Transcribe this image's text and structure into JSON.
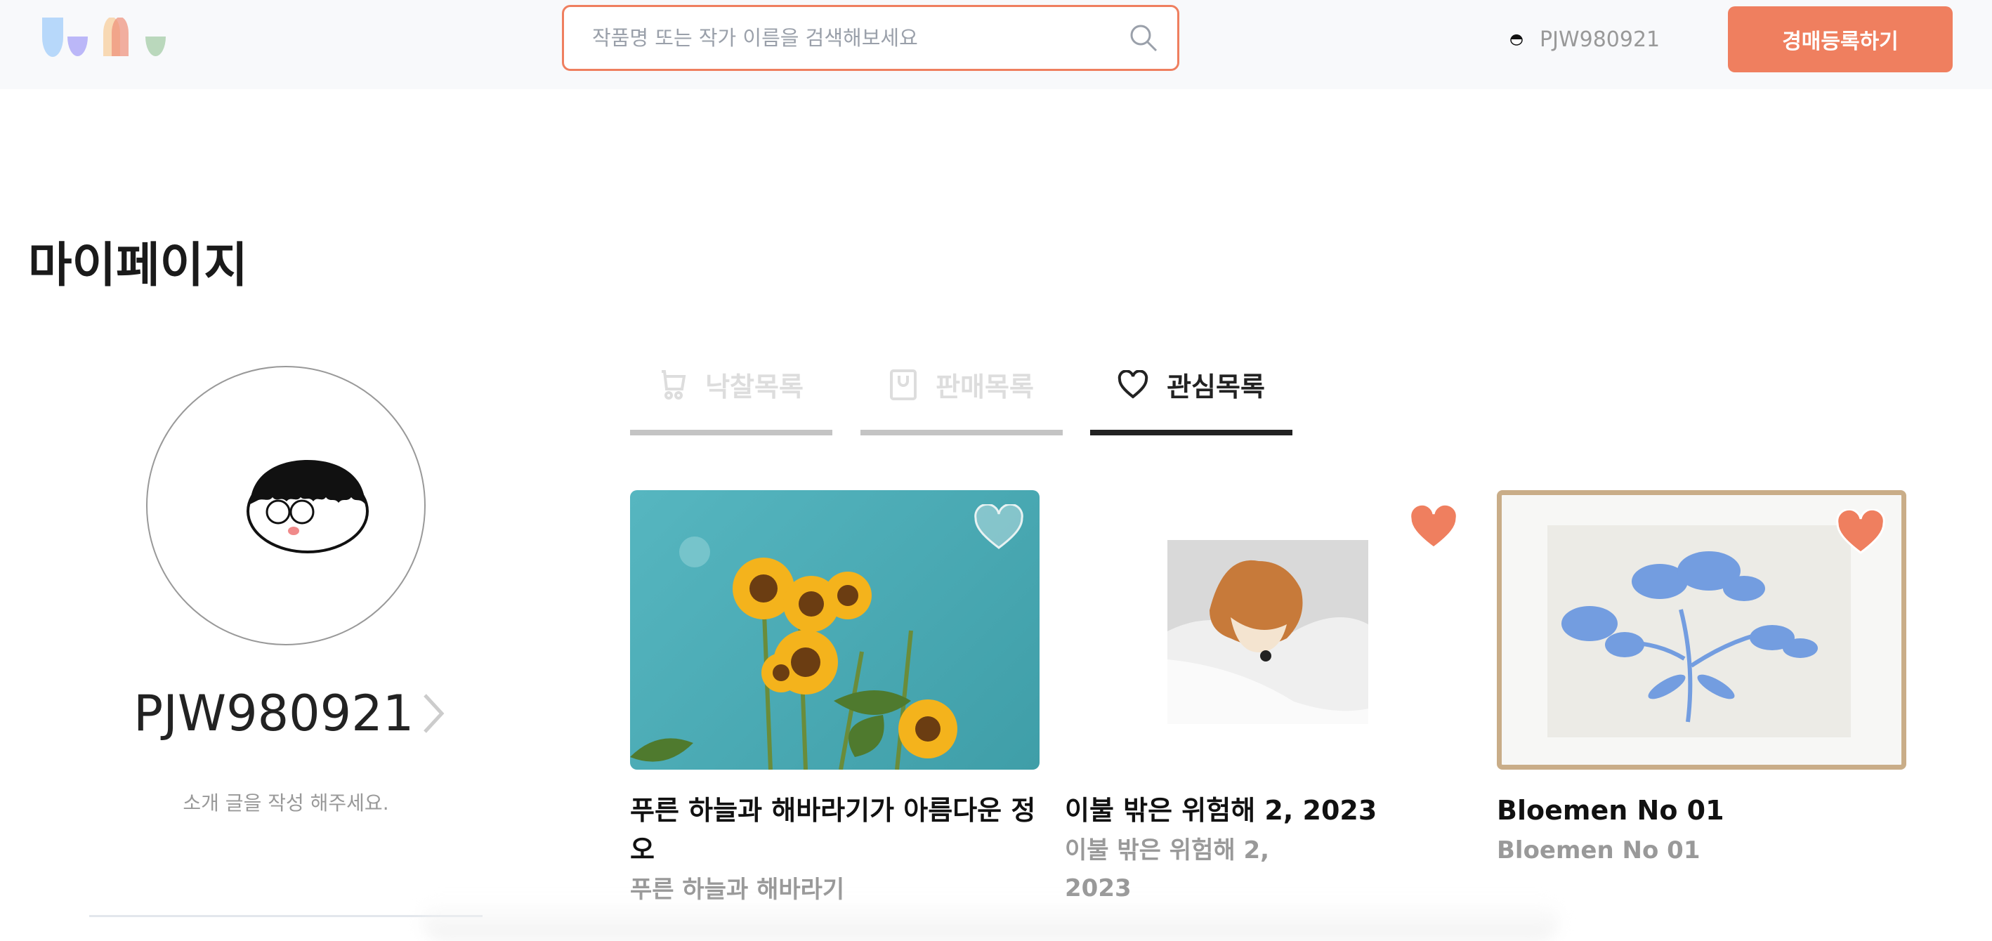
{
  "header": {
    "logo_alt": "logo",
    "search": {
      "placeholder": "작품명 또는 작가 이름을 검색해보세요",
      "value": ""
    },
    "username": "PJW980921",
    "register_button": "경매등록하기"
  },
  "page_title": "마이페이지",
  "profile": {
    "username": "PJW980921",
    "intro": "소개 글을 작성 해주세요."
  },
  "tabs": [
    {
      "label": "낙찰목록",
      "icon": "cart-icon",
      "active": false
    },
    {
      "label": "판매목록",
      "icon": "shopping-bag-icon",
      "active": false
    },
    {
      "label": "관심목록",
      "icon": "heart-outline-icon",
      "active": true
    }
  ],
  "cards": [
    {
      "title": "푸른 하늘과 해바라기가 아름다운 정오",
      "subtitle": "푸른 하늘과 해바라기",
      "liked": false
    },
    {
      "title": "이불 밖은 위험해 2, 2023",
      "subtitle": "이불 밖은 위험해 2, 2023",
      "liked": true
    },
    {
      "title": "Bloemen No 01",
      "subtitle": "Bloemen No 01",
      "liked": true
    }
  ],
  "colors": {
    "accent": "#ef7f5f",
    "header_bg": "#f8f9fb",
    "active_tab": "#222222",
    "inactive_tab": "#c4c4c4"
  }
}
